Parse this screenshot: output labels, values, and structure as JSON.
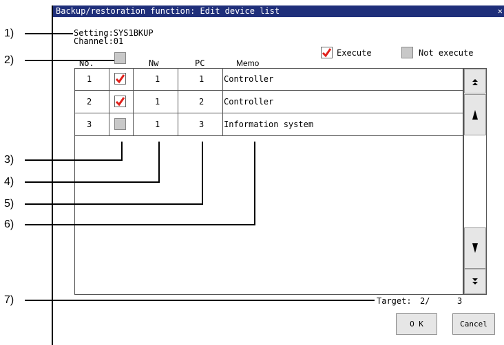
{
  "window": {
    "title": "Backup/restoration function: Edit device list",
    "close_glyph": "✕"
  },
  "header": {
    "setting": "Setting:SYS1BKUP",
    "channel": "Channel:01"
  },
  "legend": {
    "execute_label": "Execute",
    "not_execute_label": "Not execute"
  },
  "table": {
    "columns": [
      "No.",
      "Nw",
      "PC",
      "Memo"
    ],
    "rows": [
      {
        "no": "1",
        "checked": true,
        "nw": "1",
        "pc": "1",
        "memo": "Controller"
      },
      {
        "no": "2",
        "checked": true,
        "nw": "1",
        "pc": "2",
        "memo": "Controller"
      },
      {
        "no": "3",
        "checked": false,
        "nw": "1",
        "pc": "3",
        "memo": "Information system"
      }
    ]
  },
  "scrollbar": {
    "top_glyph": "⯭",
    "up_glyph": "▲",
    "down_glyph": "▼",
    "bottom_glyph": "⯯"
  },
  "footer": {
    "target_label": "Target:",
    "target_current": "2/",
    "target_total": "3"
  },
  "buttons": {
    "ok": "O K",
    "cancel": "Cancel"
  },
  "callouts": [
    "1)",
    "2)",
    "3)",
    "4)",
    "5)",
    "6)",
    "7)"
  ],
  "colors": {
    "titlebar": "#1f2f7a",
    "check": "#e0201a",
    "unchecked_box": "#c8c8c8",
    "button_bg": "#e6e6e6"
  }
}
